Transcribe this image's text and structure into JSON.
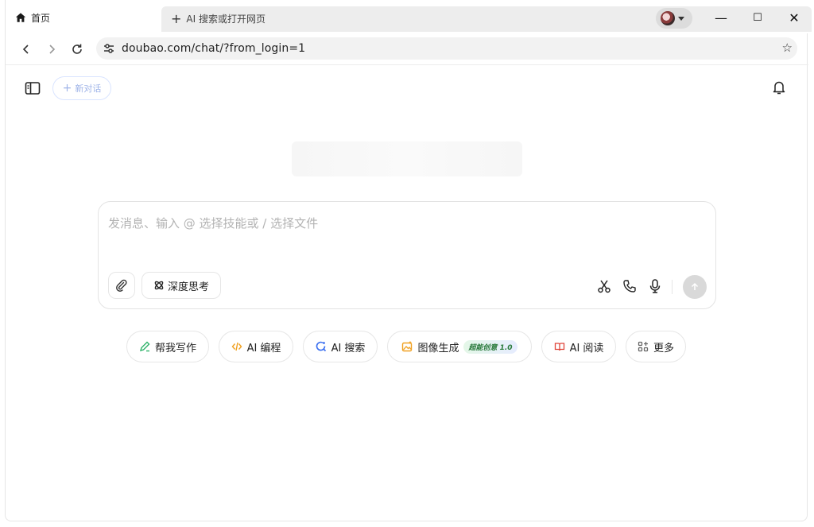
{
  "browser": {
    "home_tab_label": "首页",
    "new_tab_label": "AI 搜索或打开网页",
    "url": "doubao.com/chat/?from_login=1",
    "window_controls": {
      "minimize": "—",
      "maximize": "☐",
      "close": "✕"
    }
  },
  "app": {
    "new_chat_label": "新对话",
    "composer": {
      "placeholder": "发消息、输入 @ 选择技能或 / 选择文件",
      "deep_think_label": "深度思考"
    },
    "skills": [
      {
        "label": "帮我写作",
        "icon": "pen-icon",
        "color": "#2fb36a"
      },
      {
        "label": "AI 编程",
        "icon": "code-icon",
        "color": "#f0a020"
      },
      {
        "label": "AI 搜索",
        "icon": "search-icon",
        "color": "#3a6ff0"
      },
      {
        "label": "图像生成",
        "icon": "image-icon",
        "color": "#f0a020",
        "badge": "超能创意 1.0"
      },
      {
        "label": "AI 阅读",
        "icon": "book-icon",
        "color": "#e0453a"
      },
      {
        "label": "更多",
        "icon": "grid-icon",
        "color": "#666666"
      }
    ]
  },
  "colors": {
    "accent": "#3a6ff0",
    "omnibox_bg": "#f2f2f2",
    "tab_bg": "#ededed"
  }
}
